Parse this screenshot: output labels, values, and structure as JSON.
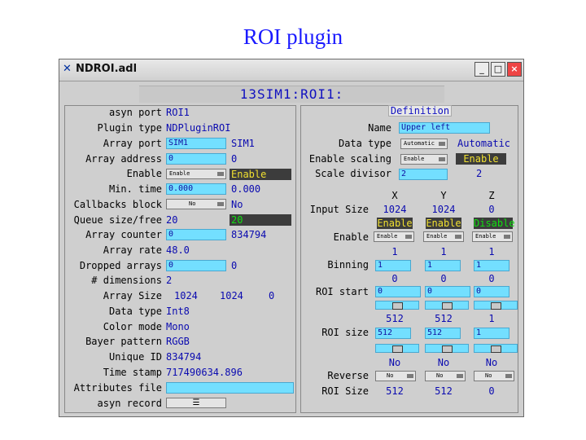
{
  "slide": {
    "title": "ROI plugin"
  },
  "window": {
    "title": "NDROI.adl",
    "buttons": {
      "minimize": "_",
      "maximize": "□",
      "close": "×"
    },
    "icon": "x-app-icon"
  },
  "banner": "13SIM1:ROI1:",
  "left": {
    "labels": [
      "asyn port",
      "Plugin type",
      "Array port",
      "Array address",
      "Enable",
      "Min. time",
      "Callbacks block",
      "Queue size/free",
      "Array counter",
      "Array rate",
      "Dropped arrays",
      "# dimensions",
      "Array Size",
      "Data type",
      "Color mode",
      "Bayer pattern",
      "Unique ID",
      "Time stamp",
      "Attributes file",
      "asyn record"
    ],
    "asyn_port": "ROI1",
    "plugin_type": "NDPluginROI",
    "array_port": {
      "input": "SIM1",
      "readback": "SIM1"
    },
    "array_address": {
      "input": "0",
      "readback": "0"
    },
    "enable": {
      "menu": "Enable",
      "readback": "Enable"
    },
    "min_time": {
      "input": "0.000",
      "readback": "0.000"
    },
    "callbacks_block": {
      "menu": "No",
      "readback": "No"
    },
    "queue": {
      "size": "20",
      "free": "20"
    },
    "array_counter": {
      "input": "0",
      "readback": "834794"
    },
    "array_rate": "48.0",
    "dropped_arrays": {
      "input": "0",
      "readback": "0"
    },
    "dimensions": "2",
    "array_size": [
      "1024",
      "1024",
      "0"
    ],
    "data_type": "Int8",
    "color_mode": "Mono",
    "bayer_pattern": "RGGB",
    "unique_id": "834794",
    "time_stamp": "717490634.896",
    "attributes_file": "",
    "asyn_record_button": "☰"
  },
  "right": {
    "header": "Definition",
    "name_label": "Name",
    "name_value": "Upper left",
    "data_type_label": "Data type",
    "data_type_menu": "Automatic",
    "data_type_readback": "Automatic",
    "enable_scaling_label": "Enable scaling",
    "enable_scaling_menu": "Enable",
    "enable_scaling_readback": "Enable",
    "scale_divisor_label": "Scale divisor",
    "scale_divisor_input": "2",
    "scale_divisor_readback": "2",
    "axes": [
      "X",
      "Y",
      "Z"
    ],
    "input_size_label": "Input Size",
    "input_size": [
      "1024",
      "1024",
      "0"
    ],
    "enable_status": [
      "Enable",
      "Enable",
      "Disable"
    ],
    "enable_label": "Enable",
    "enable_menu": [
      "Enable",
      "Enable",
      "Enable"
    ],
    "binning_label": "Binning",
    "binning_readback": [
      "1",
      "1",
      "1"
    ],
    "binning_input": [
      "1",
      "1",
      "1"
    ],
    "roi_start_label": "ROI start",
    "roi_start_readback": [
      "0",
      "0",
      "0"
    ],
    "roi_start_input": [
      "0",
      "0",
      "0"
    ],
    "roi_size_label": "ROI size",
    "roi_size_readback": [
      "512",
      "512",
      "1"
    ],
    "roi_size_input": [
      "512",
      "512",
      "1"
    ],
    "reverse_label": "Reverse",
    "reverse_readback": [
      "No",
      "No",
      "No"
    ],
    "reverse_menu": [
      "No",
      "No",
      "No"
    ],
    "roi_size_out_label": "ROI Size",
    "roi_size_out": [
      "512",
      "512",
      "0"
    ]
  },
  "colors": {
    "entry": "#73dfff",
    "readback": "#0a0ab0",
    "status_yellow": "#f0e030",
    "status_green": "#10e010",
    "panel": "#cfcfcf"
  }
}
